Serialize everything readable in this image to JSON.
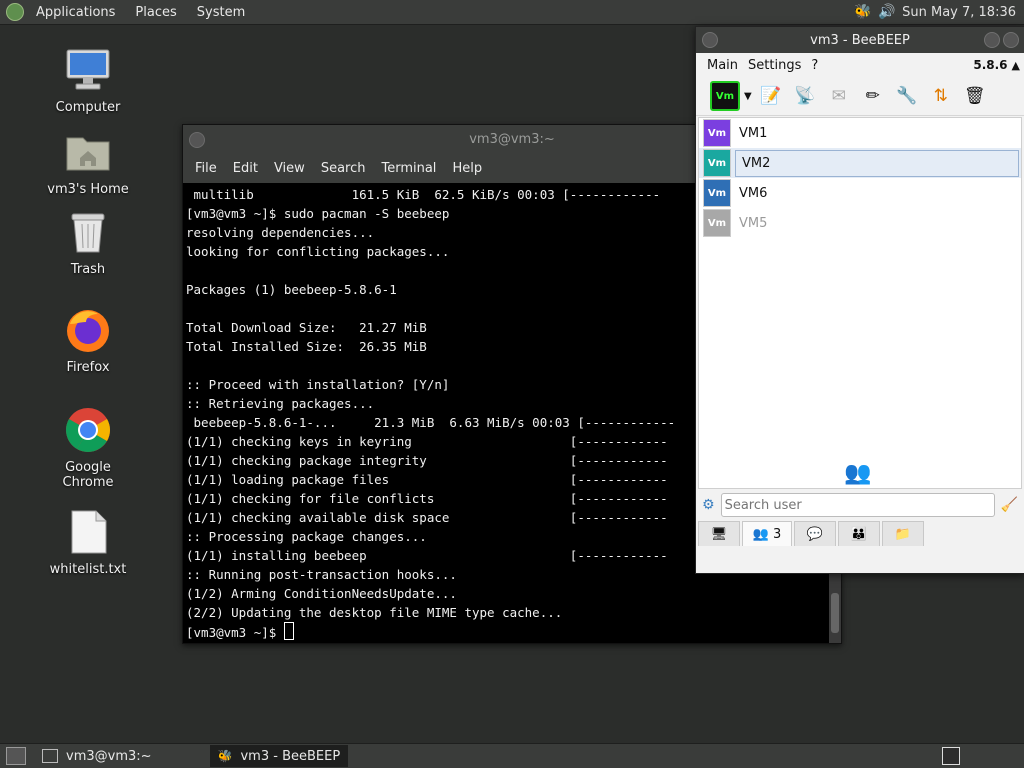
{
  "top_panel": {
    "menus": [
      "Applications",
      "Places",
      "System"
    ],
    "clock": "Sun May 7, 18:36"
  },
  "desktop": {
    "icons": [
      {
        "label": "Computer"
      },
      {
        "label": "vm3's Home"
      },
      {
        "label": "Trash"
      },
      {
        "label": "Firefox"
      },
      {
        "label": "Google Chrome"
      },
      {
        "label": "whitelist.txt"
      }
    ]
  },
  "terminal": {
    "title": "vm3@vm3:~",
    "menus": [
      "File",
      "Edit",
      "View",
      "Search",
      "Terminal",
      "Help"
    ],
    "lines": [
      " multilib             161.5 KiB  62.5 KiB/s 00:03 [------------",
      "[vm3@vm3 ~]$ sudo pacman -S beebeep",
      "resolving dependencies...",
      "looking for conflicting packages...",
      "",
      "Packages (1) beebeep-5.8.6-1",
      "",
      "Total Download Size:   21.27 MiB",
      "Total Installed Size:  26.35 MiB",
      "",
      ":: Proceed with installation? [Y/n]",
      ":: Retrieving packages...",
      " beebeep-5.8.6-1-...     21.3 MiB  6.63 MiB/s 00:03 [------------",
      "(1/1) checking keys in keyring                     [------------",
      "(1/1) checking package integrity                   [------------",
      "(1/1) loading package files                        [------------",
      "(1/1) checking for file conflicts                  [------------",
      "(1/1) checking available disk space                [------------",
      ":: Processing package changes...",
      "(1/1) installing beebeep                           [------------",
      ":: Running post-transaction hooks...",
      "(1/2) Arming ConditionNeedsUpdate...",
      "(2/2) Updating the desktop file MIME type cache..."
    ],
    "prompt": "[vm3@vm3 ~]$ "
  },
  "beebeep": {
    "title": "vm3 - BeeBEEP",
    "menus": [
      "Main",
      "Settings",
      "?"
    ],
    "version": "5.8.6",
    "users": [
      {
        "name": "VM1",
        "avatar": "Vm",
        "color": "#7b3fe0",
        "state": "online"
      },
      {
        "name": "VM2",
        "avatar": "Vm",
        "color": "#1aa8a0",
        "state": "selected"
      },
      {
        "name": "VM6",
        "avatar": "Vm",
        "color": "#2f6fb5",
        "state": "online"
      },
      {
        "name": "VM5",
        "avatar": "Vm",
        "color": "#a8a8a8",
        "state": "offline"
      }
    ],
    "search": {
      "placeholder": "Search user"
    },
    "tabs": {
      "users_count": "3"
    }
  },
  "taskbar": {
    "tasks": [
      "vm3@vm3:~",
      "vm3 - BeeBEEP"
    ]
  }
}
